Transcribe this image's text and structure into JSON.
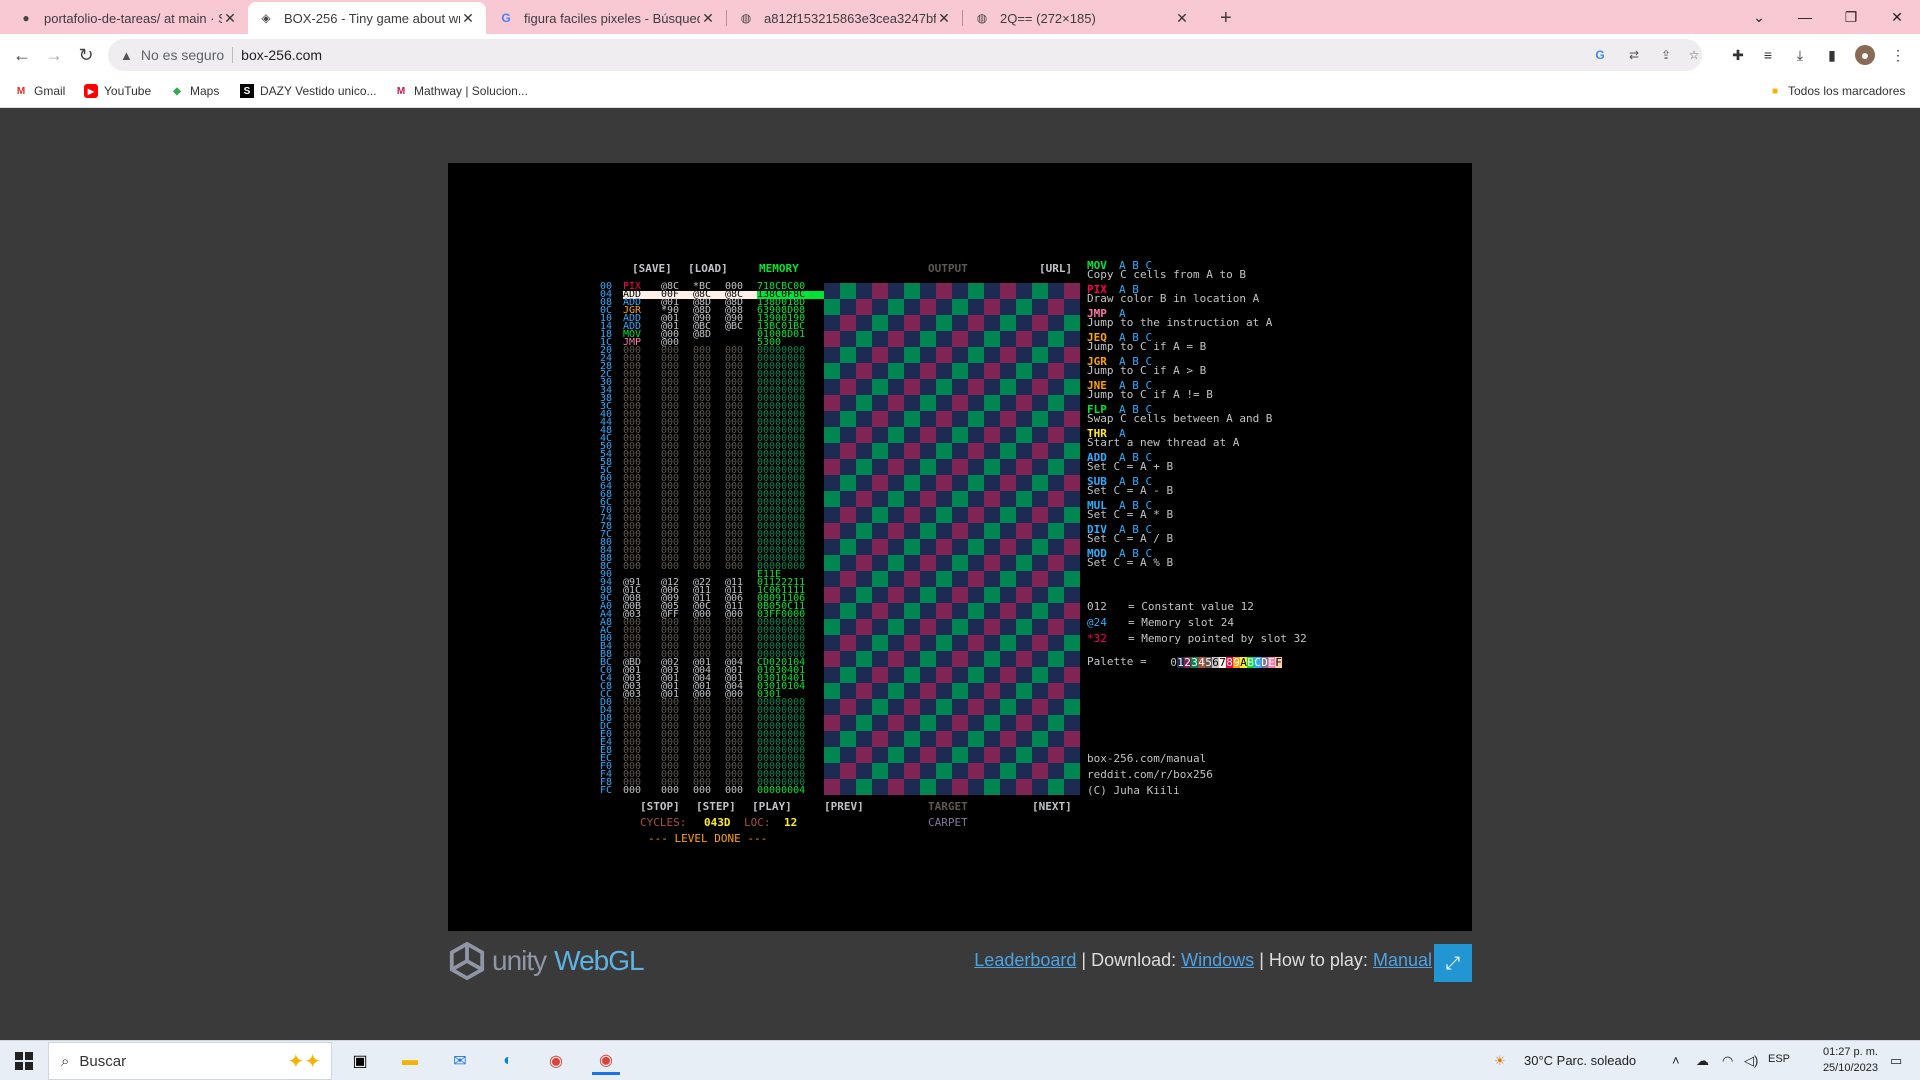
{
  "browser": {
    "tabs": [
      {
        "title": "portafolio-de-tareas/ at main · S",
        "icon": "github-icon",
        "active": false
      },
      {
        "title": "BOX-256 - Tiny game about writ",
        "icon": "unity-icon",
        "active": true
      },
      {
        "title": "figura faciles pixeles - Búsqueda",
        "icon": "google-icon",
        "active": false
      },
      {
        "title": "a812f153215863e3cea3247bf4e",
        "icon": "globe-icon",
        "active": false
      },
      {
        "title": "2Q== (272×185)",
        "icon": "globe-icon",
        "active": false
      }
    ],
    "new_tab": "+",
    "not_secure": "No es seguro",
    "url": "box-256.com",
    "bookmarks": [
      {
        "label": "Gmail",
        "icon": "gmail-icon"
      },
      {
        "label": "YouTube",
        "icon": "youtube-icon"
      },
      {
        "label": "Maps",
        "icon": "maps-icon"
      },
      {
        "label": "DAZY Vestido unico...",
        "icon": "dazy-icon"
      },
      {
        "label": "Mathway | Solucion...",
        "icon": "mathway-icon"
      }
    ],
    "all_bookmarks": "Todos los marcadores"
  },
  "game": {
    "headers": {
      "save": "[SAVE]",
      "load": "[LOAD]",
      "memory": "MEMORY",
      "output": "OUTPUT",
      "url": "[URL]"
    },
    "controls": {
      "stop": "[STOP]",
      "step": "[STEP]",
      "play": "[PLAY]",
      "prev": "[PREV]",
      "next": "[NEXT]",
      "target": "TARGET",
      "level_name": "CARPET"
    },
    "cycles_label": "CYCLES:",
    "cycles_value": "043D",
    "loc_label": "LOC:",
    "loc_value": "12",
    "level_done": "--- LEVEL DONE ---",
    "program": [
      [
        "PIX",
        "@8C",
        "*BC",
        "000",
        "718CBC00"
      ],
      [
        "ADD",
        "00F",
        "@8C",
        "@8C",
        "138C0F8C"
      ],
      [
        "ADD",
        "@01",
        "@8D",
        "@8D",
        "138D018D"
      ],
      [
        "JGR",
        "*90",
        "@8D",
        "@08",
        "63908D08"
      ],
      [
        "ADD",
        "@01",
        "@90",
        "@90",
        "13900190"
      ],
      [
        "ADD",
        "@01",
        "@BC",
        "@BC",
        "13BC01BC"
      ],
      [
        "MOV",
        "@00",
        "@8D",
        "",
        "01008D01"
      ],
      [
        "JMP",
        "@00",
        "",
        "",
        "5300"
      ]
    ],
    "data_rows": [
      {
        "row": 36,
        "cells": [
          "",
          "",
          "",
          "",
          "E11E"
        ]
      },
      {
        "row": 37,
        "cells": [
          "@91",
          "@12",
          "@22",
          "@11",
          "01122211"
        ]
      },
      {
        "row": 38,
        "cells": [
          "@1C",
          "@06",
          "@11",
          "@11",
          "1C061111"
        ]
      },
      {
        "row": 39,
        "cells": [
          "@08",
          "@09",
          "@11",
          "@06",
          "08091106"
        ]
      },
      {
        "row": 40,
        "cells": [
          "@0B",
          "@05",
          "@0C",
          "@11",
          "0B050C11"
        ]
      },
      {
        "row": 41,
        "cells": [
          "@03",
          "@FF",
          "@00",
          "@00",
          "03FF0000"
        ]
      },
      {
        "row": 47,
        "cells": [
          "@BD",
          "@02",
          "@01",
          "@04",
          "CD020104"
        ]
      },
      {
        "row": 48,
        "cells": [
          "@01",
          "@03",
          "@04",
          "@01",
          "01030401"
        ]
      },
      {
        "row": 49,
        "cells": [
          "@03",
          "@01",
          "@04",
          "@01",
          "03010401"
        ]
      },
      {
        "row": 50,
        "cells": [
          "@03",
          "@01",
          "@01",
          "@04",
          "03010104"
        ]
      },
      {
        "row": 51,
        "cells": [
          "@03",
          "@01",
          "@00",
          "@00",
          "0301"
        ]
      },
      {
        "row": 63,
        "cells": [
          "000",
          "000",
          "000",
          "000",
          "00000004"
        ]
      }
    ],
    "empty_cell": "000",
    "empty_word": "00000000",
    "docs": [
      {
        "op": "MOV",
        "args": "A B C",
        "desc": "Copy C cells from A to B",
        "color": "#00e436"
      },
      {
        "op": "PIX",
        "args": "A B",
        "desc": "Draw color B in location A",
        "color": "#ff004d"
      },
      {
        "op": "JMP",
        "args": "A",
        "desc": "Jump to the instruction at A",
        "color": "#ff77a8"
      },
      {
        "op": "JEQ",
        "args": "A B C",
        "desc": "Jump to C if A = B",
        "color": "#ffa300"
      },
      {
        "op": "JGR",
        "args": "A B C",
        "desc": "Jump to C if A > B",
        "color": "#ffa300"
      },
      {
        "op": "JNE",
        "args": "A B C",
        "desc": "Jump to C if A != B",
        "color": "#ffa300"
      },
      {
        "op": "FLP",
        "args": "A B C",
        "desc": "Swap C cells between A and B",
        "color": "#00e436"
      },
      {
        "op": "THR",
        "args": "A",
        "desc": "Start a new thread at A",
        "color": "#ffec27"
      },
      {
        "op": "ADD",
        "args": "A B C",
        "desc": "Set C = A + B",
        "color": "#29adff"
      },
      {
        "op": "SUB",
        "args": "A B C",
        "desc": "Set C = A - B",
        "color": "#29adff"
      },
      {
        "op": "MUL",
        "args": "A B C",
        "desc": "Set C = A * B",
        "color": "#29adff"
      },
      {
        "op": "DIV",
        "args": "A B C",
        "desc": "Set C = A / B",
        "color": "#29adff"
      },
      {
        "op": "MOD",
        "args": "A B C",
        "desc": "Set C = A % B",
        "color": "#29adff"
      }
    ],
    "legend": [
      {
        "sym": "012",
        "desc": "= Constant value 12",
        "color": "#c2c3c7"
      },
      {
        "sym": "@24",
        "desc": "= Memory slot 24",
        "color": "#29adff"
      },
      {
        "sym": "*32",
        "desc": "= Memory pointed by slot 32",
        "color": "#ff004d"
      }
    ],
    "palette_label": "Palette = ",
    "palette": [
      "0",
      "1",
      "2",
      "3",
      "4",
      "5",
      "6",
      "7",
      "8",
      "9",
      "A",
      "B",
      "C",
      "D",
      "E",
      "F"
    ],
    "palette_colors": [
      "#000000",
      "#1d2b53",
      "#7e2553",
      "#008751",
      "#ab5236",
      "#5f574f",
      "#c2c3c7",
      "#fff1e8",
      "#ff004d",
      "#ffa300",
      "#ffec27",
      "#00e436",
      "#29adff",
      "#83769c",
      "#ff77a8",
      "#ffccaa"
    ],
    "links": [
      "box-256.com/manual",
      "reddit.com/r/box256",
      "(C) Juha Kiili"
    ]
  },
  "footer": {
    "unity": "unity",
    "webgl": "WebGL",
    "leaderboard": "Leaderboard",
    "download_label": "| Download:",
    "windows": "Windows",
    "howto_label": "| How to play:",
    "manual": "Manual"
  },
  "taskbar": {
    "search": "Buscar",
    "weather": "30°C  Parc. soleado",
    "lang": "ESP",
    "time": "01:27 p. m.",
    "date": "25/10/2023"
  }
}
